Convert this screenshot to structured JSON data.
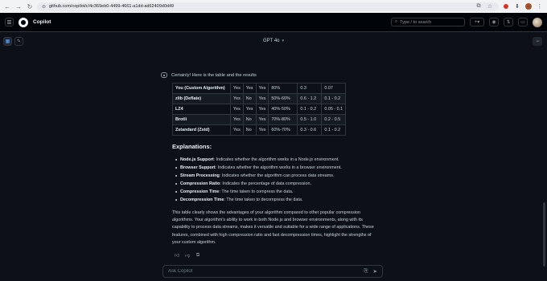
{
  "browser": {
    "url": "github.com/copilot/c/4c369eb0-4499-4661-a1dd-ad62409d0d49"
  },
  "header": {
    "title": "Copilot",
    "search_placeholder": "Type / to search",
    "plus_label": "+"
  },
  "toolbar": {
    "model": "GPT 4o"
  },
  "message": {
    "intro": "Certainly! Here is the table and the results",
    "table": [
      [
        "You (Custom Algorithm)",
        "Yes",
        "Yes",
        "Yes",
        "80%",
        "0.3",
        "0.07"
      ],
      [
        "zlib (Deflate)",
        "Yes",
        "No",
        "Yes",
        "50%-60%",
        "0.6 - 1.2",
        "0.1 - 0.2"
      ],
      [
        "LZ4",
        "Yes",
        "Yes",
        "Yes",
        "40%-50%",
        "0.1 - 0.2",
        "0.05 - 0.1"
      ],
      [
        "Brotli",
        "Yes",
        "No",
        "Yes",
        "70%-80%",
        "0.5 - 1.0",
        "0.2 - 0.5"
      ],
      [
        "Zstandard (Zstd)",
        "Yes",
        "No",
        "Yes",
        "60%-70%",
        "0.3 - 0.6",
        "0.1 - 0.2"
      ]
    ],
    "explanations_title": "Explanations:",
    "explanations": [
      {
        "term": "Node.js Support",
        "text": ": Indicates whether the algorithm works in a Node.js environment."
      },
      {
        "term": "Browser Support",
        "text": ": Indicates whether the algorithm works in a browser environment."
      },
      {
        "term": "Stream Processing",
        "text": ": Indicates whether the algorithm can process data streams."
      },
      {
        "term": "Compression Ratio",
        "text": ": Indicates the percentage of data compression."
      },
      {
        "term": "Compression Time",
        "text": ": The time taken to compress the data."
      },
      {
        "term": "Decompression Time",
        "text": ": The time taken to decompress the data."
      }
    ],
    "summary": "This table clearly shows the advantages of your algorithm compared to other popular compression algorithms. Your algorithm's ability to work in both Node.js and browser environments, along with its capability to process data streams, makes it versatile and suitable for a wide range of applications. These features, combined with high compression ratio and fast decompression times, highlight the strengths of your custom algorithm."
  },
  "input": {
    "placeholder": "Ask Copilot"
  },
  "colors": {
    "background": "#0d1117",
    "border": "#30363d",
    "accent": "#58a6ff"
  }
}
